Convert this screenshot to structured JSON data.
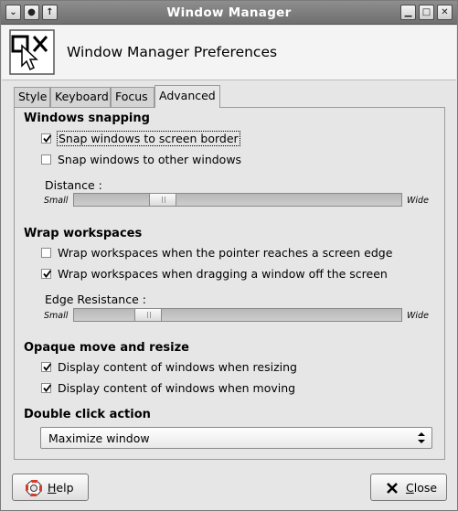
{
  "window": {
    "title": "Window Manager",
    "header_title": "Window Manager Preferences",
    "titlebar_left_icons": [
      "chevron-down-icon",
      "circle-icon",
      "arrow-up-icon"
    ],
    "titlebar_right_icons": [
      "minimize-icon",
      "maximize-icon",
      "close-icon"
    ]
  },
  "tabs": [
    {
      "label": "Style",
      "active": false
    },
    {
      "label": "Keyboard",
      "active": false
    },
    {
      "label": "Focus",
      "active": false
    },
    {
      "label": "Advanced",
      "active": true
    }
  ],
  "snapping": {
    "title": "Windows snapping",
    "options": [
      {
        "label": "Snap windows to screen border",
        "checked": true
      },
      {
        "label": "Snap windows to other windows",
        "checked": false
      }
    ],
    "distance_label": "Distance :",
    "min_label": "Small",
    "max_label": "Wide",
    "distance_level": 0.25
  },
  "wrap": {
    "title": "Wrap workspaces",
    "options": [
      {
        "label": "Wrap workspaces when the pointer reaches a screen edge",
        "checked": false
      },
      {
        "label": "Wrap workspaces when dragging a window off the screen",
        "checked": true
      }
    ],
    "resistance_label": "Edge Resistance :",
    "min_label": "Small",
    "max_label": "Wide",
    "resistance_level": 0.2
  },
  "opaque": {
    "title": "Opaque move and resize",
    "options": [
      {
        "label": "Display content of windows when resizing",
        "checked": true
      },
      {
        "label": "Display content of windows when moving",
        "checked": true
      }
    ]
  },
  "double_click": {
    "title": "Double click action",
    "selected": "Maximize window"
  },
  "buttons": {
    "help_first": "H",
    "help_rest": "elp",
    "close_first": "C",
    "close_rest": "lose"
  }
}
